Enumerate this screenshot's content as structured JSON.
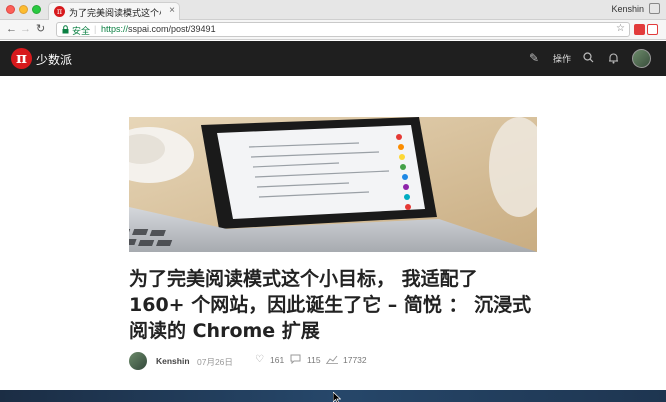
{
  "browser": {
    "tab_title": "为了完美阅读模式这个小目标…",
    "tab_close": "×",
    "user_name": "Kenshin",
    "secure_label": "安全",
    "url_scheme": "https://",
    "url_rest": "sspai.com/post/39491",
    "back_icon": "arrow-left-icon",
    "forward_icon": "arrow-right-icon",
    "reload_icon": "reload-icon",
    "star_icon": "star-icon",
    "menu_icon": "kebab-menu-icon"
  },
  "site": {
    "logo_glyph": "π",
    "logo_text": "少数派",
    "ops_label": "操作",
    "brand_color": "#d7191c",
    "header_bg": "#1f1f1f"
  },
  "article": {
    "title": "为了完美阅读模式这个小目标， 我适配了 160+ 个网站，因此诞生了它 – 简悦 ： 沉浸式阅读的 Chrome 扩展",
    "author": "Kenshin",
    "date": "07月26日",
    "likes": "161",
    "comments": "115",
    "views": "17732"
  }
}
